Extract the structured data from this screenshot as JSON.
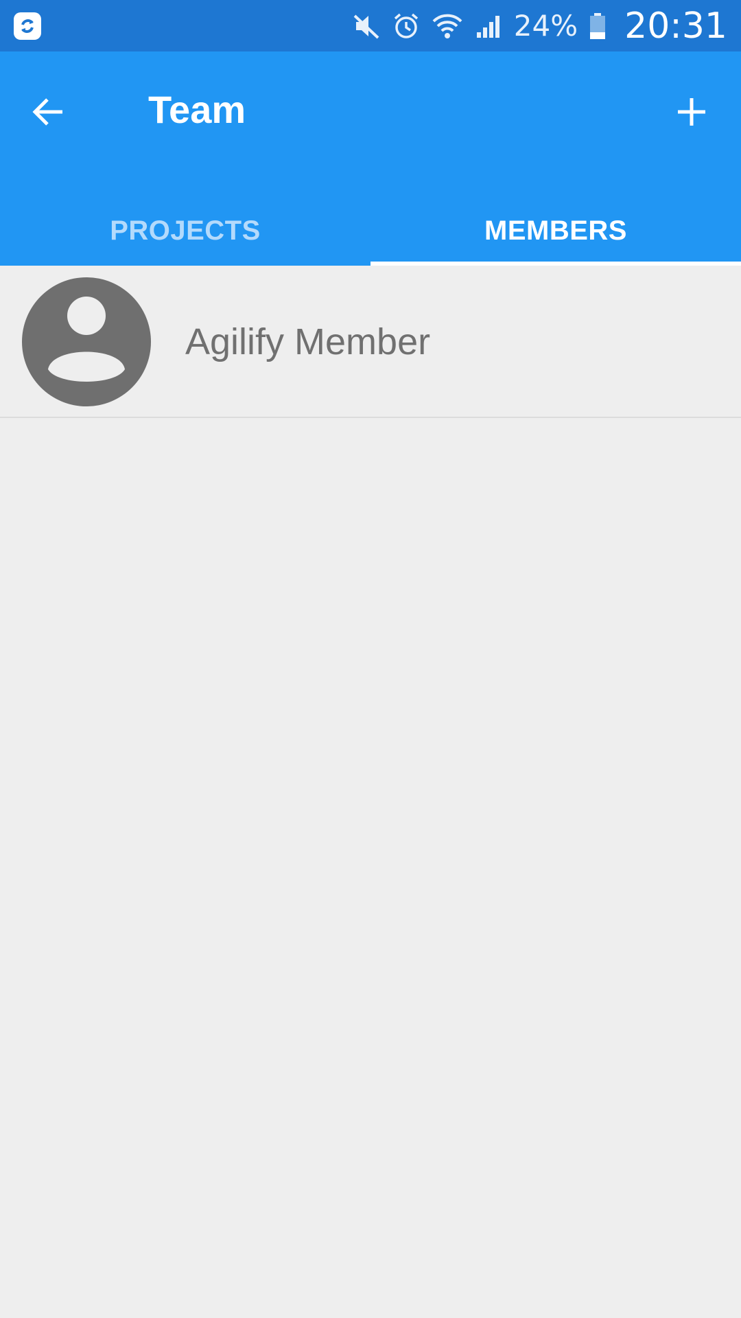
{
  "status_bar": {
    "icons": [
      "sync-app-icon",
      "mute-icon",
      "alarm-icon",
      "wifi-icon",
      "signal-icon",
      "battery-icon"
    ],
    "battery_percent": "24%",
    "time": "20:31"
  },
  "app_bar": {
    "title": "Team",
    "back_icon": "arrow-back-icon",
    "add_icon": "plus-icon"
  },
  "tabs": [
    {
      "label": "PROJECTS",
      "active": false
    },
    {
      "label": "MEMBERS",
      "active": true
    }
  ],
  "members": [
    {
      "name": "Agilify Member",
      "avatar_icon": "person-avatar-icon"
    }
  ],
  "colors": {
    "status_bar": "#1e77d2",
    "primary": "#2196f3",
    "background": "#eeeeee",
    "inactive_tab": "#b3dafc",
    "avatar": "#6f6f6f",
    "member_text": "#707070"
  }
}
